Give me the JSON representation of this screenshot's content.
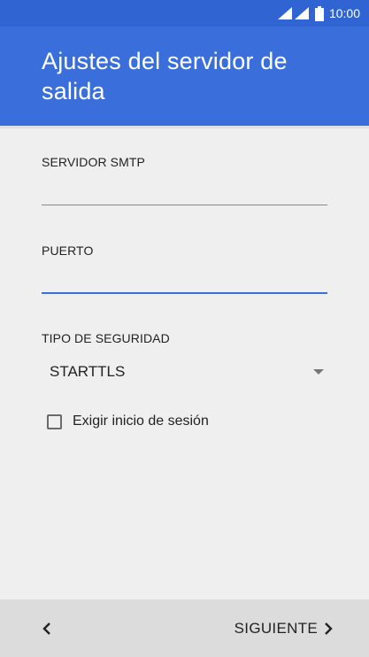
{
  "status_bar": {
    "time": "10:00"
  },
  "app_bar": {
    "title": "Ajustes del servidor de salida"
  },
  "form": {
    "smtp_server": {
      "label": "SERVIDOR SMTP",
      "value": ""
    },
    "port": {
      "label": "PUERTO",
      "value": ""
    },
    "security_type": {
      "label": "TIPO DE SEGURIDAD",
      "value": "STARTTLS"
    },
    "require_login": {
      "label": "Exigir inicio de sesión",
      "checked": false
    }
  },
  "footer": {
    "next_label": "SIGUIENTE"
  },
  "colors": {
    "primary": "#3a6fdb",
    "status_bar": "#2f64d2",
    "background": "#efefef",
    "footer": "#dcdcdc"
  }
}
